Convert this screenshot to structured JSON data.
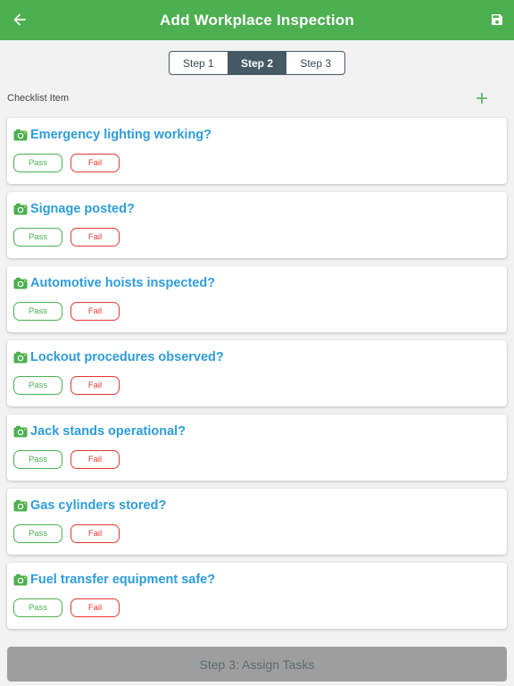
{
  "appbar": {
    "title": "Add Workplace Inspection",
    "back_icon": "arrow-left-icon",
    "save_icon": "floppy-disk-icon",
    "color": "#4caf50"
  },
  "stepper": {
    "steps": [
      "Step 1",
      "Step 2",
      "Step 3"
    ],
    "active_index": 1
  },
  "checklist": {
    "label": "Checklist Item",
    "add_icon": "plus-icon",
    "items": [
      {
        "question": "Emergency lighting working?",
        "pass": "Pass",
        "fail": "Fail"
      },
      {
        "question": "Signage posted?",
        "pass": "Pass",
        "fail": "Fail"
      },
      {
        "question": "Automotive hoists inspected?",
        "pass": "Pass",
        "fail": "Fail"
      },
      {
        "question": "Lockout procedures observed?",
        "pass": "Pass",
        "fail": "Fail"
      },
      {
        "question": "Jack stands operational?",
        "pass": "Pass",
        "fail": "Fail"
      },
      {
        "question": "Gas cylinders stored?",
        "pass": "Pass",
        "fail": "Fail"
      },
      {
        "question": "Fuel transfer equipment safe?",
        "pass": "Pass",
        "fail": "Fail"
      }
    ],
    "camera_icon": "camera-icon",
    "question_color": "#2d9cdb",
    "pass_color": "#4caf50",
    "fail_color": "#e53935"
  },
  "footer": {
    "next_label": "Step 3: Assign Tasks"
  }
}
